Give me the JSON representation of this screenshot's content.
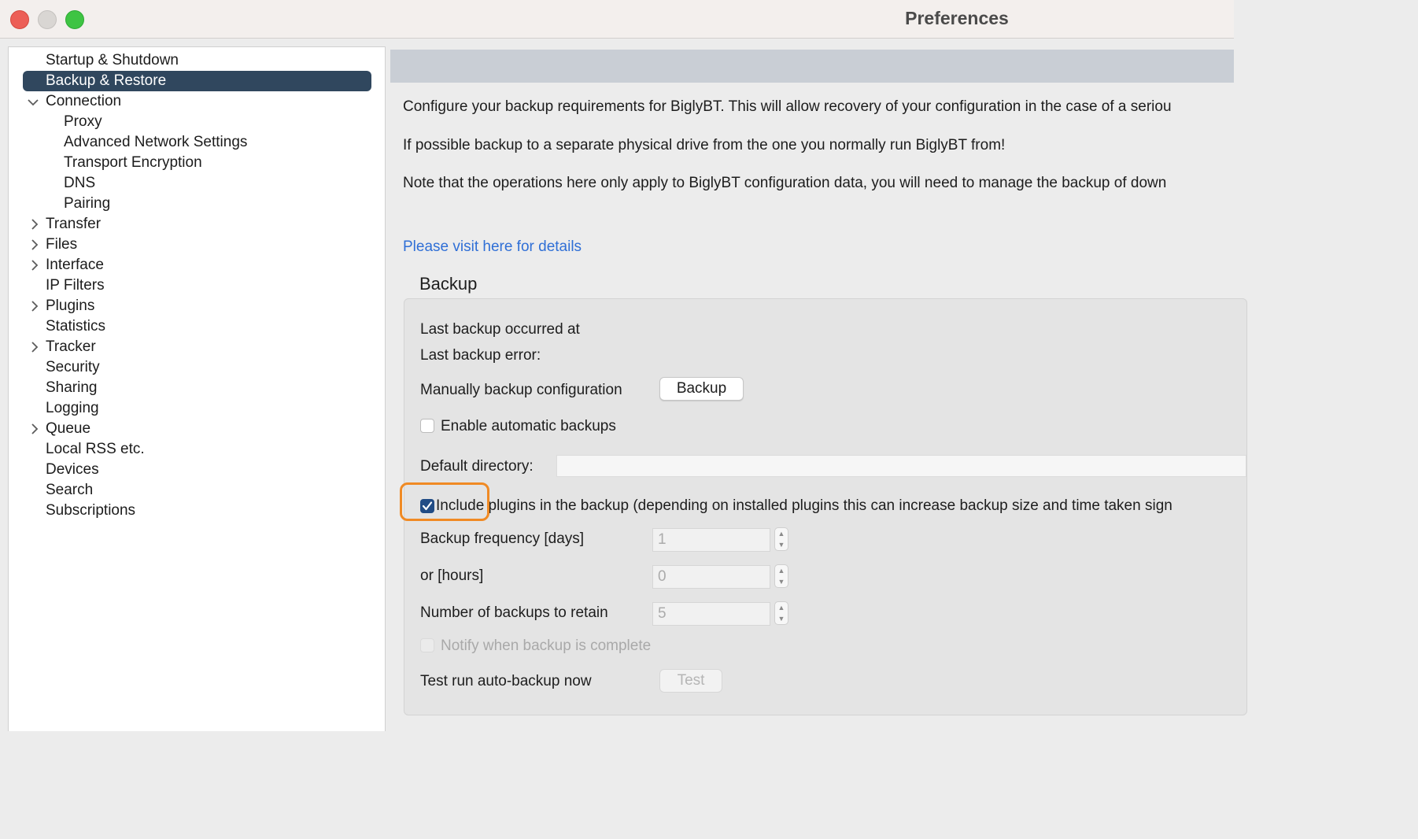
{
  "window": {
    "title": "Preferences"
  },
  "sidebar": {
    "items": [
      {
        "label": "Startup & Shutdown"
      },
      {
        "label": "Backup & Restore",
        "selected": true
      },
      {
        "label": "Connection",
        "expanded": true
      },
      {
        "label": "Proxy"
      },
      {
        "label": "Advanced Network Settings"
      },
      {
        "label": "Transport Encryption"
      },
      {
        "label": "DNS"
      },
      {
        "label": "Pairing"
      },
      {
        "label": "Transfer",
        "expandable": true
      },
      {
        "label": "Files",
        "expandable": true
      },
      {
        "label": "Interface",
        "expandable": true
      },
      {
        "label": "IP Filters"
      },
      {
        "label": "Plugins",
        "expandable": true
      },
      {
        "label": "Statistics"
      },
      {
        "label": "Tracker",
        "expandable": true
      },
      {
        "label": "Security"
      },
      {
        "label": "Sharing"
      },
      {
        "label": "Logging"
      },
      {
        "label": "Queue",
        "expandable": true
      },
      {
        "label": "Local RSS etc."
      },
      {
        "label": "Devices"
      },
      {
        "label": "Search"
      },
      {
        "label": "Subscriptions"
      }
    ],
    "chevron_expanded": "⌵",
    "chevron_collapsed": "›"
  },
  "main": {
    "intro": [
      "Configure your backup requirements for BiglyBT. This will allow recovery of your configuration in the case of a seriou",
      "If possible backup to a separate physical drive from the one you normally run BiglyBT from!",
      "Note that the operations here only apply to BiglyBT configuration data, you will need to manage the backup of down"
    ],
    "details_link": "Please visit here for details",
    "backup_group": {
      "title": "Backup",
      "last_backup_label": "Last backup occurred at",
      "last_error_label": "Last backup error:",
      "manual_label": "Manually backup configuration",
      "backup_button": "Backup",
      "enable_auto_label": "Enable automatic backups",
      "enable_auto_checked": false,
      "default_dir_label": "Default directory:",
      "default_dir_value": "",
      "include_plugins_label": "Include plugins in the backup (depending on installed plugins this can increase backup size and time taken sign",
      "include_plugins_checked": true,
      "frequency_days_label": "Backup frequency [days]",
      "frequency_days_value": "1",
      "hours_label": "or [hours]",
      "hours_value": "0",
      "retain_label": "Number of backups to retain",
      "retain_value": "5",
      "notify_label": "Notify when backup is complete",
      "notify_checked": false,
      "test_run_label": "Test run auto-backup now",
      "test_button": "Test"
    }
  },
  "colors": {
    "selection": "#30475e",
    "link": "#2f6fd6",
    "highlight": "#f08a24",
    "checkbox_checked": "#214c85"
  }
}
